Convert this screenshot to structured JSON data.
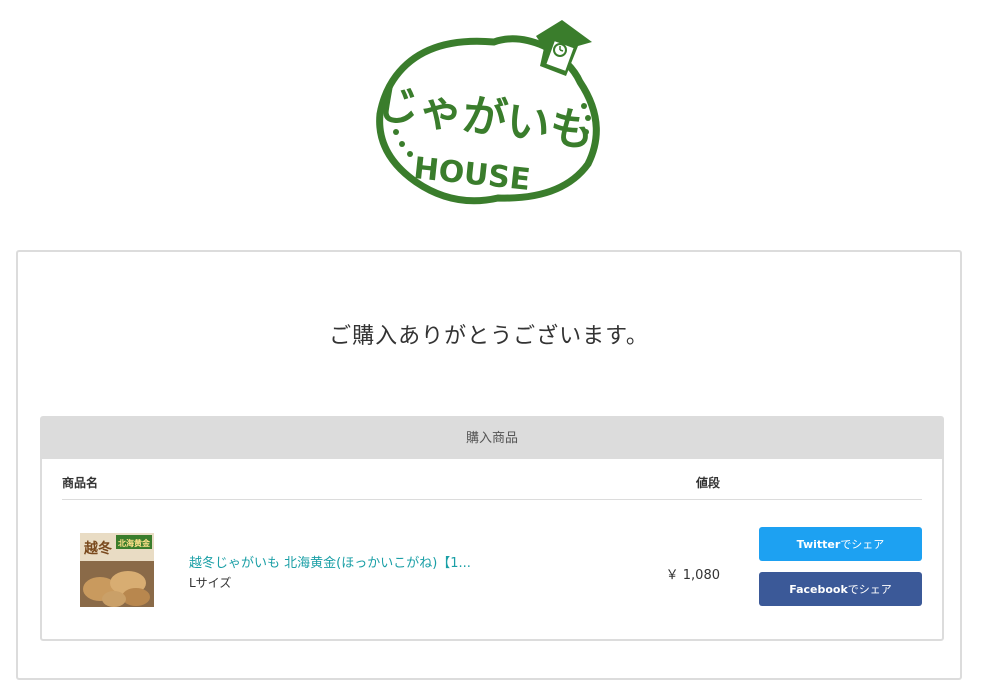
{
  "logo": {
    "line1": "じゃがいも",
    "line2": "HOUSE",
    "brand_color": "#3a7d2c"
  },
  "thanks_message": "ご購入ありがとうございます。",
  "purchase": {
    "panel_title": "購入商品",
    "columns": {
      "name": "商品名",
      "price": "値段"
    },
    "items": [
      {
        "name": "越冬じゃがいも 北海黄金(ほっかいこがね)【1...",
        "option": "Lサイズ",
        "price": "￥ 1,080",
        "thumb_text_left": "越冬",
        "thumb_text_right": "北海黄金"
      }
    ]
  },
  "share": {
    "twitter": {
      "service": "Twitter",
      "suffix": "でシェア",
      "color": "#1da1f2"
    },
    "facebook": {
      "service": "Facebook",
      "suffix": "でシェア",
      "color": "#3b5998"
    }
  },
  "colors": {
    "link": "#1a9fa6",
    "border": "#dcdcdc",
    "panel_header": "#dcdcdc"
  }
}
